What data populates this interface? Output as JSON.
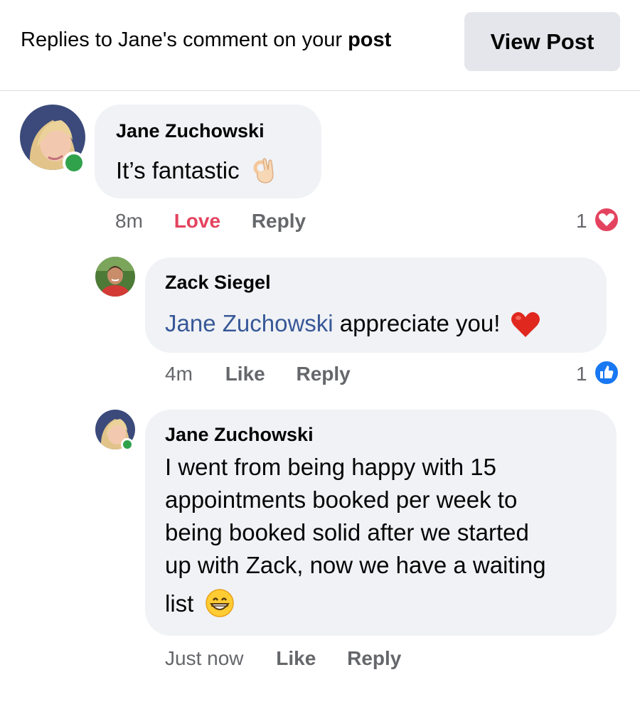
{
  "header": {
    "text_prefix": "Replies to Jane's comment on your ",
    "text_bold": "post",
    "view_post_label": "View Post"
  },
  "comments": [
    {
      "author": "Jane Zuchowski",
      "text": "It’s fantastic",
      "emoji": "ok-hand",
      "time": "8m",
      "action1": "Love",
      "action2": "Reply",
      "reaction_count": "1",
      "reaction_icon": "heart-reaction",
      "online": true
    },
    {
      "author": "Zack Siegel",
      "mention": "Jane Zuchowski",
      "text": " appreciate you!",
      "emoji": "red-heart",
      "time": "4m",
      "action1": "Like",
      "action2": "Reply",
      "reaction_count": "1",
      "reaction_icon": "like-reaction",
      "online": false
    },
    {
      "author": "Jane Zuchowski",
      "lines": [
        "I went from being happy with 15",
        "appointments booked per week to",
        "being booked solid after we started",
        "up with Zack, now we have a waiting",
        "list"
      ],
      "emoji": "grinning-face",
      "time": "Just now",
      "action1": "Like",
      "action2": "Reply",
      "online": true
    }
  ],
  "colors": {
    "bubble": "#f0f2f5",
    "love": "#e4435f",
    "like_blue": "#1877f2",
    "online": "#31a24c",
    "mention": "#385898"
  }
}
